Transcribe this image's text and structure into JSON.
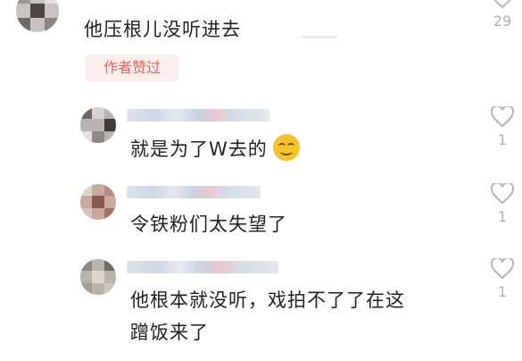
{
  "comments": [
    {
      "text": "他压根儿没听进去",
      "badge": "作者赞过",
      "likes": "29"
    },
    {
      "text": "就是为了W去的",
      "emoji": "smiling-face-with-sunglasses-icon",
      "likes": "1"
    },
    {
      "text": "令铁粉们太失望了",
      "likes": "1"
    },
    {
      "text_line1": "他根本就没听，戏拍不了了在这",
      "text_line2": "蹭饭来了",
      "likes": "1"
    }
  ],
  "colors": {
    "badge_bg": "#fbeeec",
    "badge_text": "#e2665d",
    "like_count": "#b0b0b0",
    "text": "#222222"
  }
}
